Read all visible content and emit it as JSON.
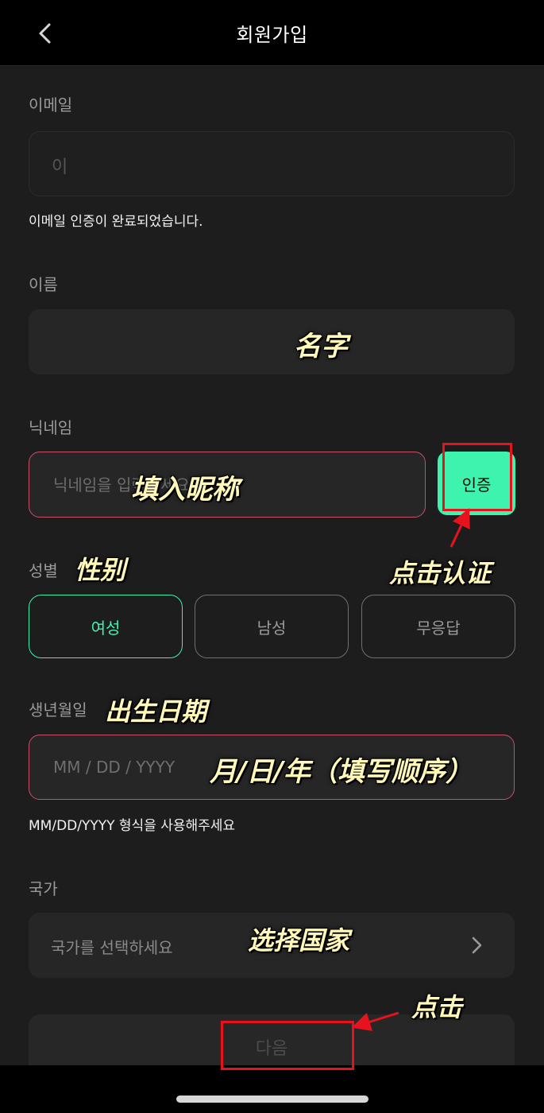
{
  "header": {
    "title": "회원가입",
    "back_icon": "chevron-left-icon"
  },
  "form": {
    "email": {
      "label": "이메일",
      "visible_char": "이",
      "helper_text": "이메일 인증이 완료되었습니다."
    },
    "name": {
      "label": "이름"
    },
    "nickname": {
      "label": "닉네임",
      "placeholder": "닉네임을 입력하세요",
      "verify_button": "인증"
    },
    "gender": {
      "label": "성별",
      "options": [
        "여성",
        "남성",
        "무응답"
      ],
      "selected": "여성"
    },
    "birthday": {
      "label": "생년월일",
      "placeholder": "MM / DD / YYYY",
      "helper_text": "MM/DD/YYYY 형식을 사용해주세요"
    },
    "country": {
      "label": "국가",
      "placeholder": "국가를 선택하세요",
      "icon": "chevron-right-icon"
    },
    "next_button": "다음"
  },
  "annotations": {
    "name": "名字",
    "nickname": "填入昵称",
    "verify": "点击认证",
    "gender": "性别",
    "birthday": "出生日期",
    "date_format": "月/日/年（填写顺序）",
    "country": "选择国家",
    "click": "点击"
  },
  "colors": {
    "accent": "#3ef3ad",
    "error_border": "#c9506a",
    "annotation_red": "#e8121e",
    "annotation_text": "#fff8b8"
  }
}
